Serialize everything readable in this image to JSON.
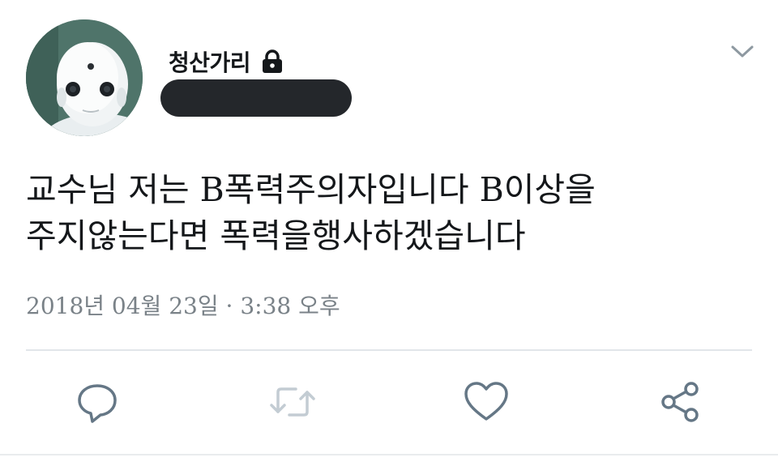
{
  "tweet": {
    "author": {
      "display_name": "청산가리",
      "protected_icon": "lock-icon",
      "handle": "",
      "avatar_icon": "robot-avatar"
    },
    "menu_icon": "chevron-down-icon",
    "text_line_1": "교수님 저는 B폭력주의자입니다 B이상을",
    "text_line_2": "주지않는다면 폭력을행사하겠습니다",
    "date": "2018년 04월 23일",
    "separator": "·",
    "time": "3:38 오후",
    "actions": [
      {
        "name": "reply",
        "icon": "reply-icon"
      },
      {
        "name": "retweet",
        "icon": "retweet-icon"
      },
      {
        "name": "like",
        "icon": "heart-icon"
      },
      {
        "name": "share",
        "icon": "share-icon"
      }
    ],
    "colors": {
      "text": "#14171a",
      "secondary_text": "#7a8288",
      "icon": "#657786",
      "retweet_disabled": "#c3ccd3",
      "divider": "#e1e6ea"
    }
  }
}
